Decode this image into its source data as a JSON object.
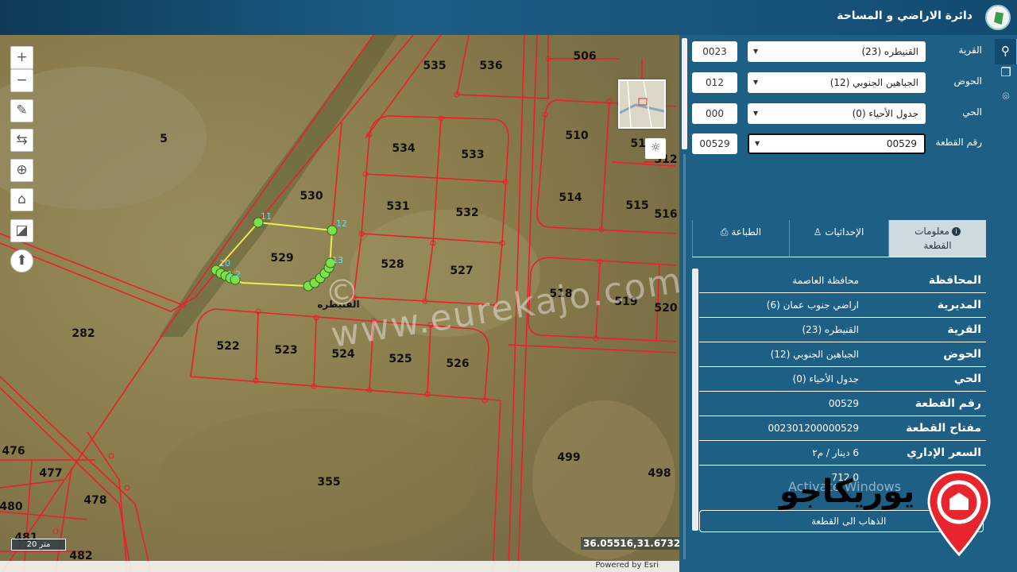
{
  "app": {
    "title": "دائرة الاراضي و المساحة"
  },
  "map": {
    "parcels": [
      {
        "label": "535"
      },
      {
        "label": "536"
      },
      {
        "label": "506"
      },
      {
        "label": "5"
      },
      {
        "label": "534"
      },
      {
        "label": "533"
      },
      {
        "label": "510"
      },
      {
        "label": "511"
      },
      {
        "label": "512"
      },
      {
        "label": "530"
      },
      {
        "label": "531"
      },
      {
        "label": "532"
      },
      {
        "label": "514"
      },
      {
        "label": "515"
      },
      {
        "label": "516"
      },
      {
        "label": "529"
      },
      {
        "label": "528"
      },
      {
        "label": "527"
      },
      {
        "label": "518"
      },
      {
        "label": "519"
      },
      {
        "label": "520"
      },
      {
        "label": "282"
      },
      {
        "label": "522"
      },
      {
        "label": "523"
      },
      {
        "label": "524"
      },
      {
        "label": "525"
      },
      {
        "label": "526"
      },
      {
        "label": "499"
      },
      {
        "label": "498"
      },
      {
        "label": "476"
      },
      {
        "label": "477"
      },
      {
        "label": "478"
      },
      {
        "label": "480"
      },
      {
        "label": "355"
      },
      {
        "label": "481"
      },
      {
        "label": "482"
      }
    ],
    "vertex_labels": [
      "11",
      "12",
      "13",
      "10",
      "1",
      "2"
    ],
    "place_label": "القنيطره",
    "scale": "20 متر",
    "coordinates": "36.05516,31.67321",
    "attribution": "Powered by Esri",
    "controls": {
      "zoom_in": "+",
      "zoom_out": "−"
    }
  },
  "search": {
    "village": {
      "label": "القرية",
      "code": "0023",
      "value": "القنيطره (23)"
    },
    "basin": {
      "label": "الحوض",
      "code": "012",
      "value": "الجباهين الجنوبي (12)"
    },
    "district": {
      "label": "الحي",
      "code": "000",
      "value": "جدول الأحياء (0)"
    },
    "parcel": {
      "label": "رقم القطعة",
      "code": "00529",
      "value": "00529"
    }
  },
  "tabs": {
    "info": "معلومات القطعة",
    "coords": "الإحداثيات",
    "print": "الطباعة"
  },
  "info": [
    {
      "key": "المحافظة",
      "value": "محافظة العاصمة"
    },
    {
      "key": "المديرية",
      "value": "اراضي جنوب عمان (6)"
    },
    {
      "key": "القرية",
      "value": "القنيطره (23)"
    },
    {
      "key": "الحوض",
      "value": "الجباهين الجنوبي (12)"
    },
    {
      "key": "الحي",
      "value": "جدول الأحياء (0)"
    },
    {
      "key": "رقم القطعة",
      "value": "00529"
    },
    {
      "key": "مفتاح القطعة",
      "value": "002301200000529"
    },
    {
      "key": "السعر الإداري",
      "value": "6 دينار / م٢"
    },
    {
      "key": "",
      "value": "712.0"
    }
  ],
  "goto_label": "الذهاب الى القطعة",
  "watermark": {
    "site": "© www.eurekajo.com",
    "brand": "يوريكاجو",
    "activate": "Activate Windows"
  },
  "colors": {
    "panel": "#1e5f86",
    "parcel_line": "#e8202a",
    "selected_outline": "#e8f04a",
    "vertex": "#7ee04a"
  }
}
